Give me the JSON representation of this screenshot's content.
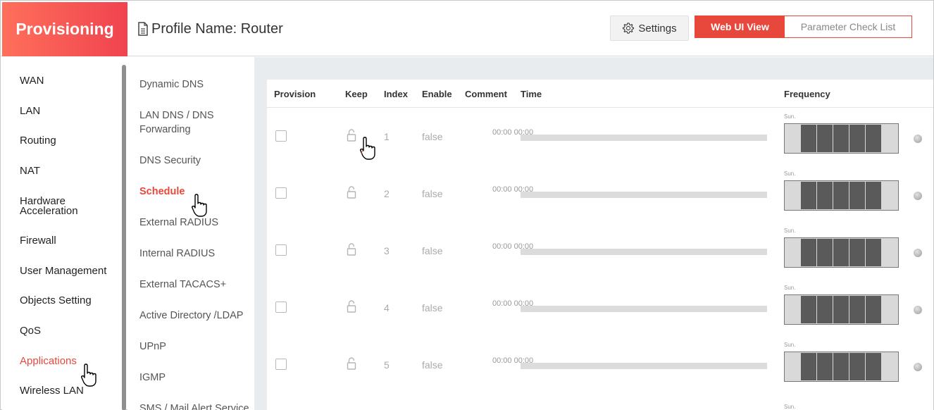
{
  "header": {
    "brand": "Provisioning",
    "profile_title": "Profile Name: Router",
    "settings_label": "Settings",
    "web_ui_view_label": "Web UI View",
    "parameter_check_list_label": "Parameter Check List"
  },
  "nav": {
    "items": [
      "WAN",
      "LAN",
      "Routing",
      "NAT",
      "Hardware Acceleration",
      "Firewall",
      "User Management",
      "Objects Setting",
      "QoS",
      "Applications",
      "Wireless LAN"
    ],
    "active": "Applications"
  },
  "subnav": {
    "items": [
      "Dynamic DNS",
      "LAN DNS / DNS Forwarding",
      "DNS Security",
      "Schedule",
      "External RADIUS",
      "Internal RADIUS",
      "External TACACS+",
      "Active Directory /LDAP",
      "UPnP",
      "IGMP",
      "SMS / Mail Alert Service"
    ],
    "active": "Schedule"
  },
  "table": {
    "columns": [
      "Provision",
      "Keep",
      "Index",
      "Enable",
      "Comment",
      "Time",
      "Frequency"
    ],
    "rows": [
      {
        "index": "1",
        "enable": "false",
        "time": "00:00 00:00",
        "day": "Sun."
      },
      {
        "index": "2",
        "enable": "false",
        "time": "00:00 00:00",
        "day": "Sun."
      },
      {
        "index": "3",
        "enable": "false",
        "time": "00:00 00:00",
        "day": "Sun."
      },
      {
        "index": "4",
        "enable": "false",
        "time": "00:00 00:00",
        "day": "Sun."
      },
      {
        "index": "5",
        "enable": "false",
        "time": "00:00 00:00",
        "day": "Sun."
      }
    ],
    "partial_row_day": "Sun."
  },
  "colors": {
    "accent": "#e8483c",
    "brand_gradient_start": "#ff6f5a",
    "brand_gradient_end": "#f0434f"
  },
  "icons": [
    "document-icon",
    "gear-icon",
    "lock-icon",
    "hand-cursor-icon"
  ]
}
